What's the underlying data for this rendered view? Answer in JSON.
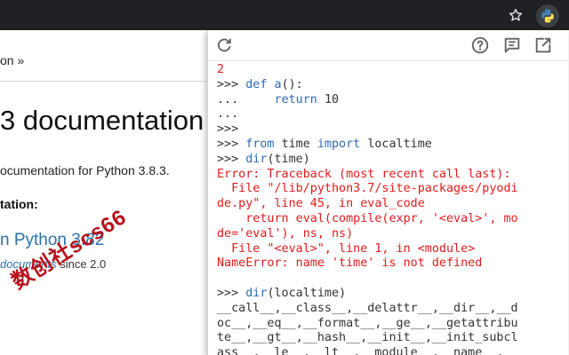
{
  "docs": {
    "breadcrumb": "on »",
    "title": "3 documentation",
    "subtitle": "ocumentation for Python 3.8.3.",
    "section_heading": "tation:",
    "link_text": "n Python 3.82",
    "since_prefix": "",
    "since_link": "documents",
    "since_suffix": " since 2.0"
  },
  "watermark": "数创社scs66",
  "toolbar": {
    "icons": [
      "refresh-icon",
      "help-icon",
      "feedback-icon",
      "open-external-icon"
    ]
  },
  "console": {
    "lines": [
      {
        "text": "2",
        "style": "err"
      },
      {
        "text": ">>> def a():",
        "style": "normal"
      },
      {
        "text": "...     return 10",
        "style": "normal"
      },
      {
        "text": "...",
        "style": "normal"
      },
      {
        "text": ">>>",
        "style": "normal"
      },
      {
        "text": ">>> from time import localtime",
        "style": "normal"
      },
      {
        "text": ">>> dir(time)",
        "style": "normal"
      },
      {
        "text": "Error: Traceback (most recent call last):",
        "style": "err"
      },
      {
        "text": "  File \"/lib/python3.7/site-packages/pyodi",
        "style": "err"
      },
      {
        "text": "de.py\", line 45, in eval_code",
        "style": "err"
      },
      {
        "text": "    return eval(compile(expr, '<eval>', mo",
        "style": "err"
      },
      {
        "text": "de='eval'), ns, ns)",
        "style": "err"
      },
      {
        "text": "  File \"<eval>\", line 1, in <module>",
        "style": "err"
      },
      {
        "text": "NameError: name 'time' is not defined",
        "style": "err"
      },
      {
        "text": "",
        "style": "normal"
      },
      {
        "text": ">>> dir(localtime)",
        "style": "normal"
      },
      {
        "text": "__call__,__class__,__delattr__,__dir__,__d",
        "style": "normal"
      },
      {
        "text": "oc__,__eq__,__format__,__ge__,__getattribu",
        "style": "normal"
      },
      {
        "text": "te__,__gt__,__hash__,__init__,__init_subcl",
        "style": "normal"
      },
      {
        "text": "ass__,__le__,__lt__,__module__,__name__,",
        "style": "normal"
      }
    ]
  }
}
